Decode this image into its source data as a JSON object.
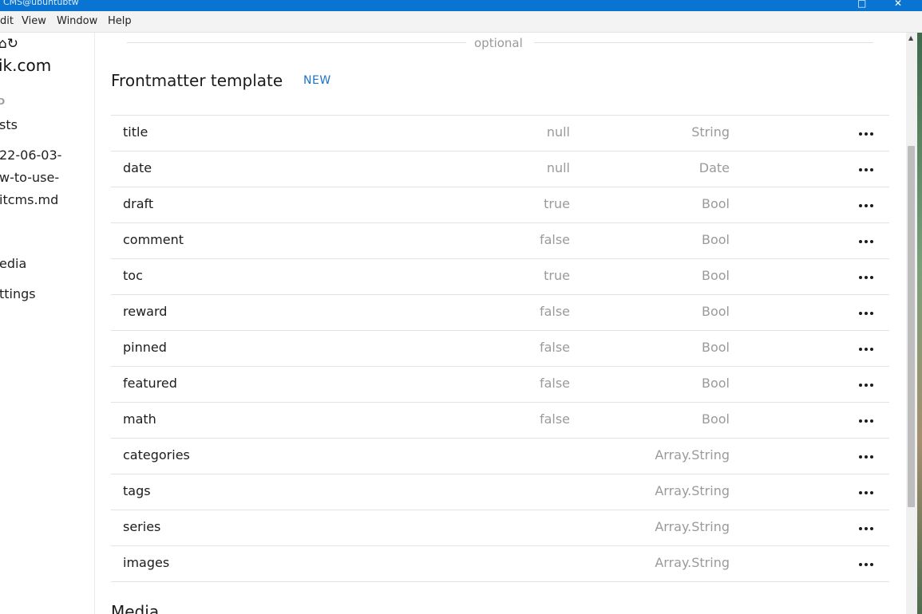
{
  "window": {
    "title": "CMS@ubuntubtw"
  },
  "menu": [
    "dit",
    "View",
    "Window",
    "Help"
  ],
  "sidebar": {
    "icons": "⌂↻",
    "site": "ik.com",
    "section": "D",
    "items": [
      {
        "label": "sts"
      },
      {
        "label": "22-06-03-"
      },
      {
        "label": "w-to-use-"
      },
      {
        "label": "itcms.md"
      },
      {
        "label": "edia"
      },
      {
        "label": "ttings"
      }
    ]
  },
  "main": {
    "divider_label": "optional",
    "section_title": "Frontmatter template",
    "new_label": "NEW",
    "rows": [
      {
        "name": "title",
        "default": "null",
        "type": "String"
      },
      {
        "name": "date",
        "default": "null",
        "type": "Date"
      },
      {
        "name": "draft",
        "default": "true",
        "type": "Bool"
      },
      {
        "name": "comment",
        "default": "false",
        "type": "Bool"
      },
      {
        "name": "toc",
        "default": "true",
        "type": "Bool"
      },
      {
        "name": "reward",
        "default": "false",
        "type": "Bool"
      },
      {
        "name": "pinned",
        "default": "false",
        "type": "Bool"
      },
      {
        "name": "featured",
        "default": "false",
        "type": "Bool"
      },
      {
        "name": "math",
        "default": "false",
        "type": "Bool"
      },
      {
        "name": "categories",
        "default": "",
        "type": "Array.String"
      },
      {
        "name": "tags",
        "default": "",
        "type": "Array.String"
      },
      {
        "name": "series",
        "default": "",
        "type": "Array.String"
      },
      {
        "name": "images",
        "default": "",
        "type": "Array.String"
      }
    ],
    "next_section_title": "Media"
  }
}
